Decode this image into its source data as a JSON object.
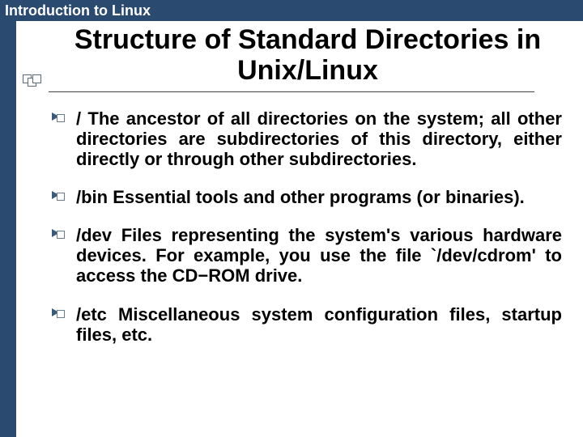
{
  "header": {
    "course": "Introduction to Linux"
  },
  "title": "Structure of Standard Directories in Unix/Linux",
  "items": [
    "/ The ancestor of all directories on the system; all other directories are subdirectories of this directory, either directly or through other subdirectories.",
    "/bin Essential tools and other programs (or binaries).",
    "/dev Files representing the system's various hardware devices. For example, you use the file `/dev/cdrom' to access the CD−ROM drive.",
    "/etc Miscellaneous system configuration files, startup files, etc."
  ]
}
